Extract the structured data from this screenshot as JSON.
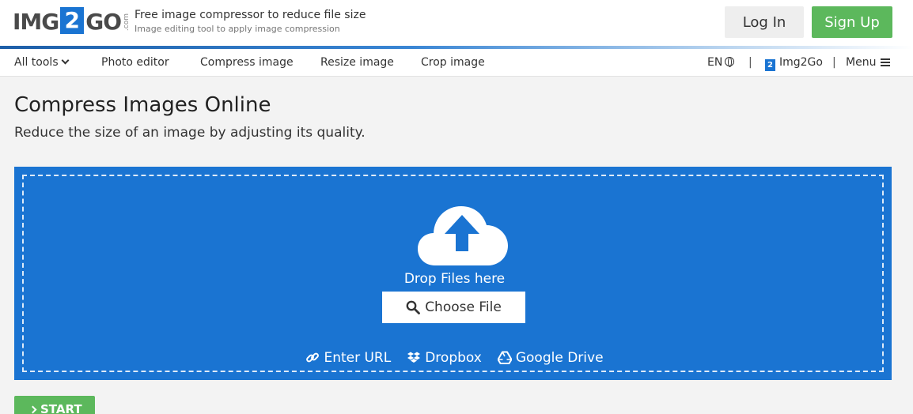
{
  "header": {
    "logo": {
      "part1": "IMG",
      "part2": "2",
      "part3": "GO",
      "suffix": ".com"
    },
    "tagline": "Free image compressor to reduce file size",
    "subtagline": "Image editing tool to apply image compression",
    "login_label": "Log In",
    "signup_label": "Sign Up"
  },
  "nav": {
    "all_tools": "All tools",
    "items": [
      "Photo editor",
      "Compress image",
      "Resize image",
      "Crop image"
    ],
    "language": "EN",
    "separator": "|",
    "brand_link": "Img2Go",
    "menu": "Menu"
  },
  "main": {
    "title": "Compress Images Online",
    "description": "Reduce the size of an image by adjusting its quality."
  },
  "upload": {
    "drop_text": "Drop Files here",
    "choose_label": "Choose File",
    "sources": [
      {
        "label": "Enter URL",
        "icon": "link-icon"
      },
      {
        "label": "Dropbox",
        "icon": "dropbox-icon"
      },
      {
        "label": "Google Drive",
        "icon": "google-drive-icon"
      }
    ]
  },
  "actions": {
    "start_label": "START"
  },
  "colors": {
    "brand_blue": "#1a74d2",
    "green": "#5cb85c",
    "background": "#f3f3f3"
  }
}
